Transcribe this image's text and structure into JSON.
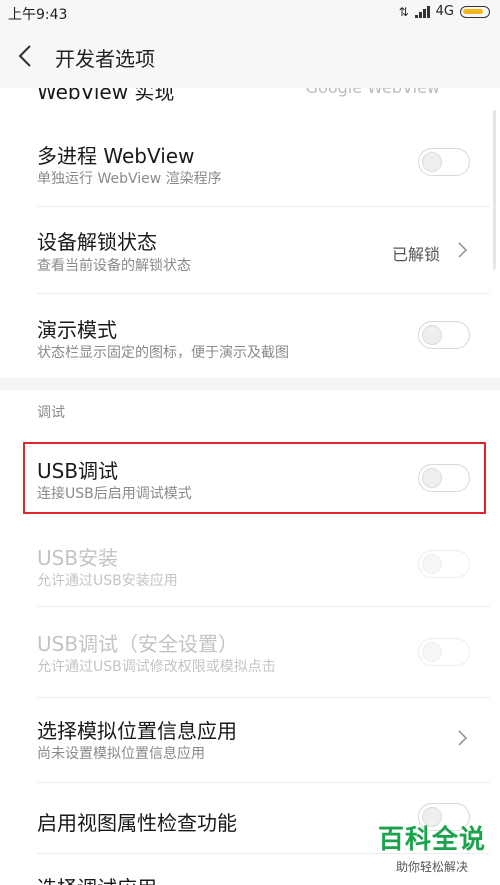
{
  "status_bar": {
    "time": "上午9:43",
    "network": "4G"
  },
  "header": {
    "title": "开发者选项"
  },
  "rows": {
    "webview_impl": {
      "title": "WebView 实现",
      "value": "Google WebView"
    },
    "multiprocess": {
      "title": "多进程 WebView",
      "subtitle": "单独运行 WebView 渲染程序",
      "enabled": false
    },
    "unlock_status": {
      "title": "设备解锁状态",
      "subtitle": "查看当前设备的解锁状态",
      "value": "已解锁"
    },
    "demo_mode": {
      "title": "演示模式",
      "subtitle": "状态栏显示固定的图标，便于演示及截图",
      "enabled": false
    },
    "usb_debug": {
      "title": "USB调试",
      "subtitle": "连接USB后启用调试模式",
      "enabled": false
    },
    "usb_install": {
      "title": "USB安装",
      "subtitle": "允许通过USB安装应用",
      "enabled": false
    },
    "usb_debug_secure": {
      "title": "USB调试（安全设置）",
      "subtitle": "允许通过USB调试修改权限或模拟点击",
      "enabled": false
    },
    "mock_location": {
      "title": "选择模拟位置信息应用",
      "subtitle": "尚未设置模拟位置信息应用"
    },
    "view_attr": {
      "title": "启用视图属性检查功能",
      "enabled": false
    },
    "select_debug_app": {
      "title": "选择调试应用"
    }
  },
  "section": {
    "debug_label": "调试"
  },
  "watermark": {
    "main": "百科全说",
    "sub": "助你轻松解决"
  },
  "colors": {
    "highlight": "#e0262b",
    "watermark": "#1aa34a"
  }
}
